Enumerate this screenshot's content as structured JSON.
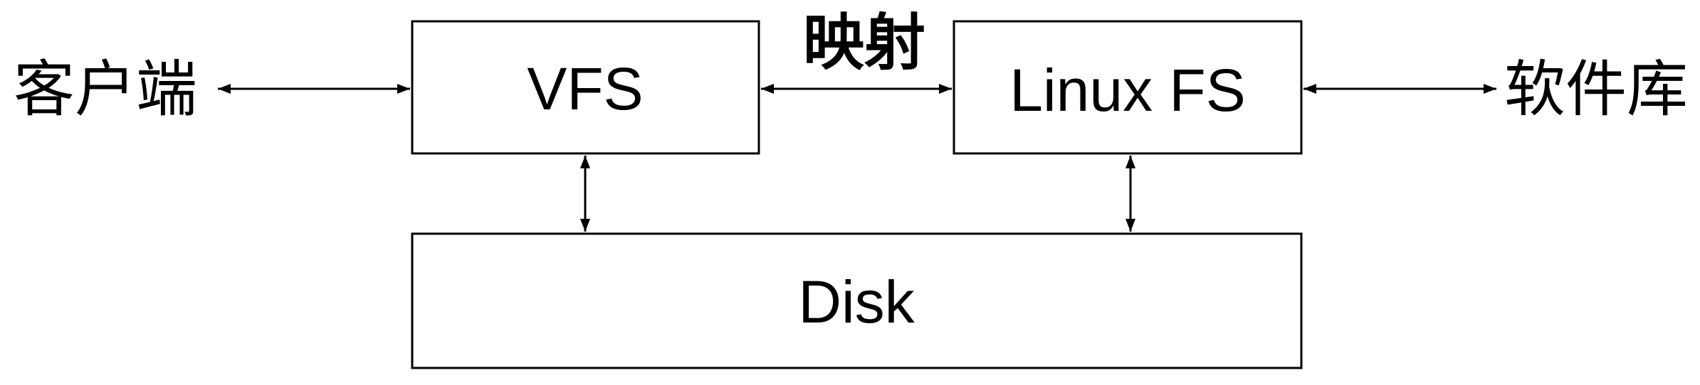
{
  "diagram": {
    "client_label": "客户端",
    "vfs_label": "VFS",
    "mapping_label": "映射",
    "linux_fs_label": "Linux FS",
    "software_repo_label": "软件库",
    "disk_label": "Disk"
  }
}
